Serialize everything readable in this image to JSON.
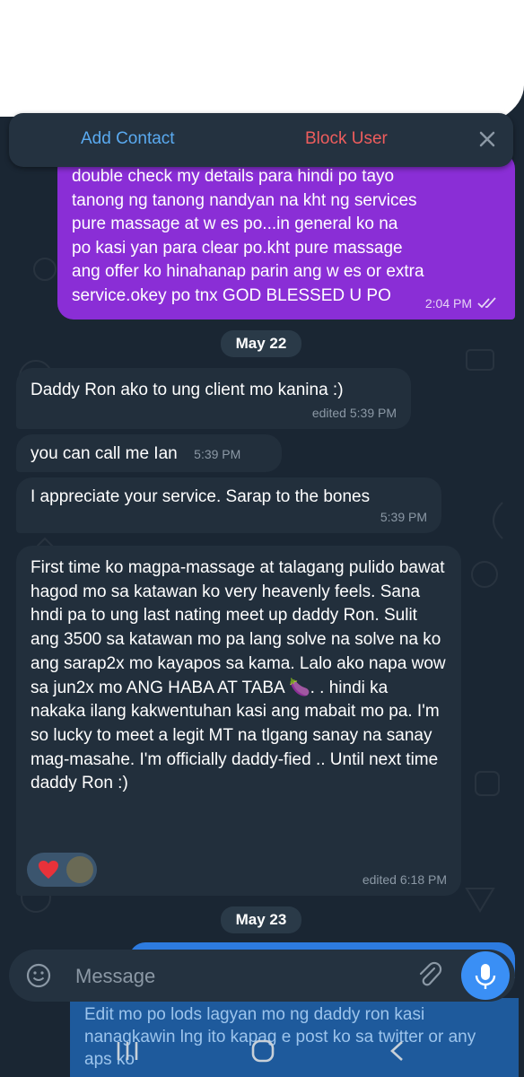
{
  "header_actions": {
    "add_contact": "Add Contact",
    "block_user": "Block User"
  },
  "messages": [
    {
      "direction": "out",
      "text": "double check my details para hindi po tayo\ntanong ng tanong nandyan na kht ng services\npure massage at w es po...in general ko na\npo kasi yan para clear   po.kht pure massage\nang offer ko hinahanap parin ang w es or extra\nservice.okey po tnx GOD BLESSED U PO",
      "time": "2:04 PM"
    },
    {
      "type": "date",
      "label": "May 22"
    },
    {
      "direction": "in",
      "text": "Daddy Ron ako to ung client mo kanina :)",
      "time": "edited 5:39 PM"
    },
    {
      "direction": "in",
      "text": "you can call me Ian",
      "time": "5:39 PM"
    },
    {
      "direction": "in",
      "text": "I appreciate your service. Sarap to the bones",
      "time": "5:39 PM"
    },
    {
      "direction": "in",
      "text": "First time ko magpa-massage at talagang pulido bawat hagod mo sa katawan ko very heavenly feels. Sana hndi pa to ung last nating meet up daddy Ron. Sulit ang 3500  sa katawan mo pa lang solve na solve na ko ang sarap2x mo kayapos sa kama. Lalo ako napa wow sa jun2x mo ANG HABA AT TABA 🍆. . hindi ka nakaka ilang kakwentuhan kasi ang mabait mo pa. I'm so lucky to meet a legit MT na tlgang sanay na sanay mag-masahe. I'm officially daddy-fied .. Until next time daddy Ron :)",
      "time": "edited 6:18 PM",
      "reactions": [
        "heart",
        "avatar"
      ]
    },
    {
      "type": "date",
      "label": "May 23"
    }
  ],
  "composer": {
    "placeholder": "Message",
    "preview_text": "Edit mo po lods lagyan mo ng daddy ron kasi nanagkawin lng ito kapag e post ko sa twitter or any aps ko"
  },
  "icons": [
    "close-icon",
    "double-check-icon",
    "emoji-icon",
    "attach-icon",
    "mic-icon",
    "recents-icon",
    "home-icon",
    "back-icon",
    "wifi-icon",
    "signal-icon",
    "battery-icon"
  ],
  "colors": {
    "background": "#1a2633",
    "outgoing_bubble": "#8a2ed6",
    "incoming_bubble": "#222f3c",
    "accent_blue": "#3a8ff5",
    "danger_red": "#ef5d5d"
  }
}
